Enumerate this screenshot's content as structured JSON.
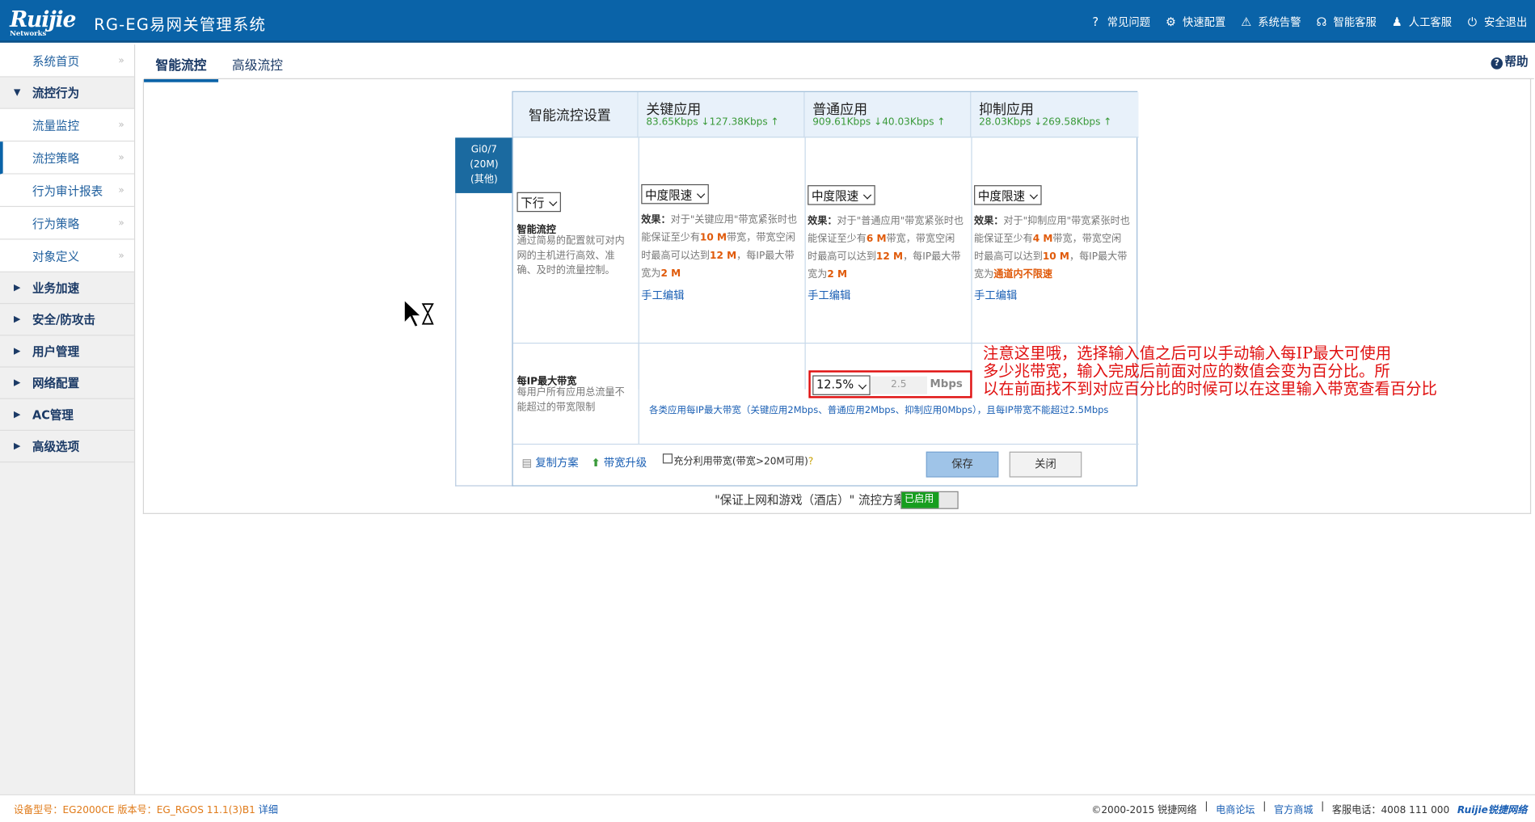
{
  "app": {
    "logo": "Ruijie",
    "logo_sub": "Networks",
    "title": "RG-EG易网关管理系统"
  },
  "topnav": [
    {
      "icon": "question-icon",
      "label": "常见问题"
    },
    {
      "icon": "gear-icon",
      "label": "快速配置"
    },
    {
      "icon": "warning-icon",
      "label": "系统告警"
    },
    {
      "icon": "headset-icon",
      "label": "智能客服"
    },
    {
      "icon": "user-icon",
      "label": "人工客服"
    },
    {
      "icon": "power-icon",
      "label": "安全退出"
    }
  ],
  "sidebar": {
    "home": "系统首页",
    "group_flow": "流控行为",
    "flow_items": [
      "流量监控",
      "流控策略",
      "行为审计报表",
      "行为策略",
      "对象定义"
    ],
    "groups": [
      "业务加速",
      "安全/防攻击",
      "用户管理",
      "网络配置",
      "AC管理",
      "高级选项"
    ],
    "arrow": "»"
  },
  "tabs": {
    "smart": "智能流控",
    "advanced": "高级流控",
    "help": "帮助"
  },
  "port": {
    "name": "Gi0/7",
    "bw": "(20M)",
    "type": "(其他)"
  },
  "grid": {
    "settings_title": "智能流控设置",
    "direction": "下行",
    "smart_label": "智能流控",
    "smart_desc": "通过简易的配置就可对内网的主机进行高效、准确、及时的流量控制。",
    "apps": [
      {
        "title": "关键应用",
        "rate": "83.65Kbps ↓127.38Kbps ↑",
        "level": "中度限速",
        "e1": "效果：",
        "e2": "对于\"关键应用\"带宽紧张时也能保证至少有",
        "g": "10 M",
        "e3": "带宽，带宽空闲时最高可以达到",
        "m": "12 M",
        "e4": "，每IP最大带宽为",
        "p": "2 M",
        "edit": "手工编辑"
      },
      {
        "title": "普通应用",
        "rate": "909.61Kbps ↓40.03Kbps ↑",
        "level": "中度限速",
        "e1": "效果：",
        "e2": "对于\"普通应用\"带宽紧张时也能保证至少有",
        "g": "6 M",
        "e3": "带宽，带宽空闲时最高可以达到",
        "m": "12 M",
        "e4": "，每IP最大带宽为",
        "p": "2 M",
        "edit": "手工编辑"
      },
      {
        "title": "抑制应用",
        "rate": "28.03Kbps ↓269.58Kbps ↑",
        "level": "中度限速",
        "e1": "效果：",
        "e2": "对于\"抑制应用\"带宽紧张时也能保证至少有",
        "g": "4 M",
        "e3": "带宽，带宽空闲时最高可以达到",
        "m": "10 M",
        "e4": "，每IP最大带宽为",
        "p": "通道内不限速",
        "edit": "手工编辑"
      }
    ],
    "perip_label": "每IP最大带宽",
    "perip_desc": "每用户所有应用总流量不能超过的带宽限制",
    "perip_pct": "12.5%",
    "perip_value": "2.5",
    "perip_unit": "Mbps",
    "perip_note": "各类应用每IP最大带宽（关键应用2Mbps、普通应用2Mbps、抑制应用0Mbps），且每IP带宽不能超过2.5Mbps",
    "copy": "复制方案",
    "upgrade": "带宽升级",
    "spare": "充分利用带宽(带宽>20M可用)",
    "save": "保存",
    "close": "关闭"
  },
  "annotation": [
    "注意这里哦，选择输入值之后可以手动输入每IP最大可使用",
    "多少兆带宽，输入完成后前面对应的数值会变为百分比。所",
    "以在前面找不到对应百分比的时候可以在这里输入带宽查看百分比"
  ],
  "plan": {
    "label": "\"保证上网和游戏（酒店）\" 流控方案",
    "status": "已启用"
  },
  "footer": {
    "model": "设备型号：EG2000CE 版本号：EG_RGOS 11.1(3)B1",
    "detail": "详细",
    "copyright": "©2000-2015 锐捷网络",
    "forum": "电商论坛",
    "shop": "官方商城",
    "phone": "客服电话：4008 111 000",
    "brand": "Ruijie锐捷网络"
  },
  "colors": {
    "header": "#0a63a8",
    "accent": "#e05a0a",
    "annotation": "#e01010",
    "enabled": "#179e1f"
  }
}
